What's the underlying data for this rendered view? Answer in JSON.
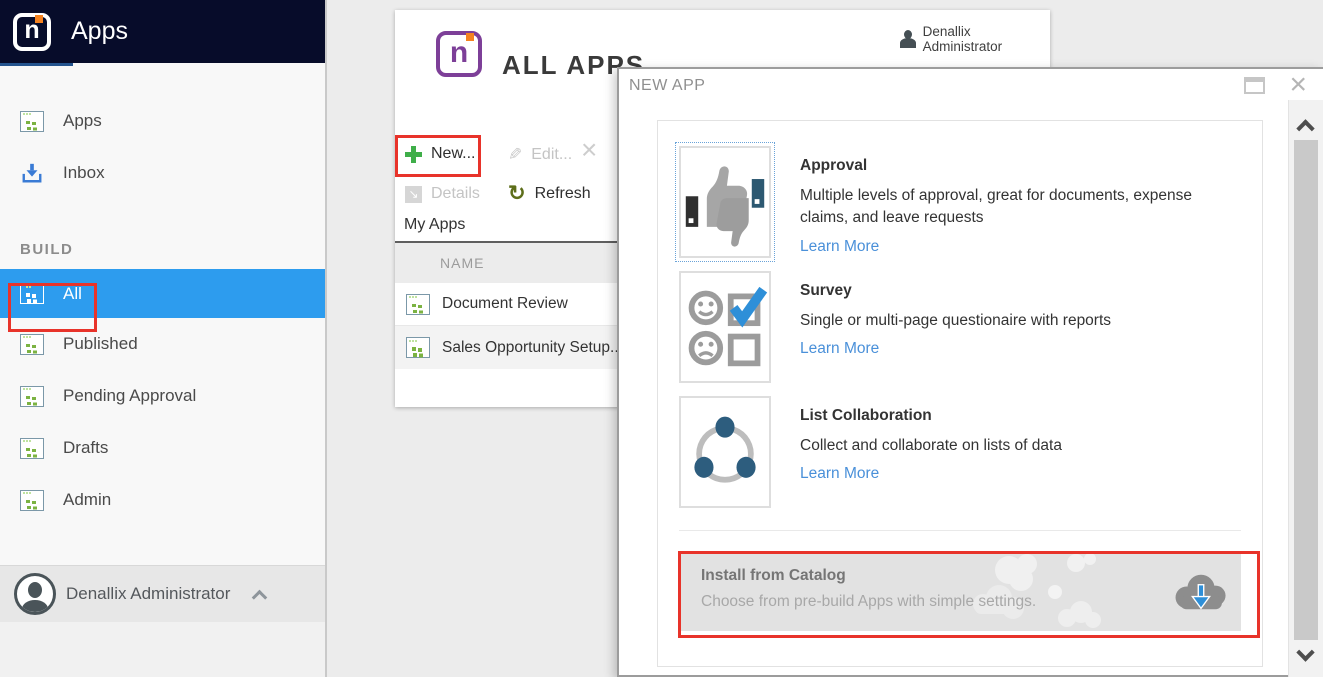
{
  "app": {
    "logo_letter": "n",
    "header_title": "Apps"
  },
  "sidebar": {
    "nav": [
      {
        "label": "Apps"
      },
      {
        "label": "Inbox"
      }
    ],
    "section_label": "BUILD",
    "build": [
      {
        "label": "All",
        "selected": true,
        "annotated": true
      },
      {
        "label": "Published"
      },
      {
        "label": "Pending Approval"
      },
      {
        "label": "Drafts"
      },
      {
        "label": "Admin"
      }
    ],
    "user_name": "Denallix Administrator"
  },
  "main": {
    "logo_letter": "n",
    "title": "ALL APPS",
    "user_name": "Denallix Administrator",
    "toolbar": {
      "new": "New...",
      "edit": "Edit...",
      "details": "Details",
      "refresh": "Refresh"
    },
    "tab": "My Apps",
    "table": {
      "name_column": "NAME",
      "rows": [
        {
          "name": "Document Review"
        },
        {
          "name": "Sales Opportunity Setup..."
        }
      ]
    }
  },
  "modal": {
    "title": "NEW APP",
    "templates": [
      {
        "name": "Approval",
        "description": "Multiple levels of approval, great for documents, expense claims, and leave requests",
        "link": "Learn More",
        "icon": "thumbs-up-down-icon"
      },
      {
        "name": "Survey",
        "description": "Single or multi-page questionaire with reports",
        "link": "Learn More",
        "icon": "survey-faces-checkbox-icon"
      },
      {
        "name": "List Collaboration",
        "description": "Collect and collaborate on lists of data",
        "link": "Learn More",
        "icon": "connected-circles-icon"
      }
    ],
    "catalog": {
      "title": "Install from Catalog",
      "subtitle": "Choose from pre-build Apps with simple settings.",
      "icon": "cloud-download-icon"
    }
  },
  "colors": {
    "header_navy": "#070c2a",
    "selected_blue": "#2d9cee",
    "annotation_red": "#e8332a",
    "link_blue": "#4a90d9",
    "brand_purple": "#7d3f98",
    "brand_orange": "#f58220"
  }
}
